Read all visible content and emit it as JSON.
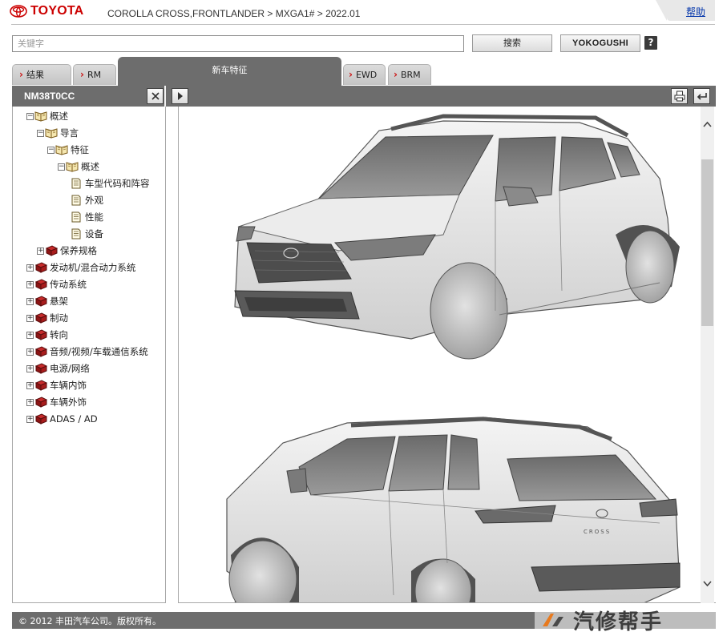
{
  "header": {
    "brand": "TOYOTA",
    "breadcrumb": "COROLLA CROSS,FRONTLANDER > MXGA1# > 2022.01",
    "help_link": "帮助"
  },
  "search": {
    "placeholder": "关键字",
    "search_button": "搜索",
    "yokogushi_button": "YOKOGUSHI",
    "help_icon": "?"
  },
  "tabs": [
    {
      "label": "结果",
      "active": false
    },
    {
      "label": "RM",
      "active": false
    },
    {
      "label": "新车特征",
      "active": true
    },
    {
      "label": "EWD",
      "active": false
    },
    {
      "label": "BRM",
      "active": false
    }
  ],
  "toolbar": {
    "doc_code": "NM38T0CC",
    "close_icon": "close-icon",
    "next_icon": "play-right-icon",
    "print_icon": "print-icon",
    "back_icon": "return-icon"
  },
  "tree": [
    {
      "label": "概述",
      "level": 0,
      "icon": "open-book-icon",
      "expander": "minus"
    },
    {
      "label": "导言",
      "level": 1,
      "icon": "open-book-icon",
      "expander": "minus"
    },
    {
      "label": "特征",
      "level": 2,
      "icon": "open-book-icon",
      "expander": "minus"
    },
    {
      "label": "概述",
      "level": 3,
      "icon": "open-book-icon",
      "expander": "minus"
    },
    {
      "label": "车型代码和阵容",
      "level": 4,
      "icon": "document-icon",
      "expander": "none"
    },
    {
      "label": "外观",
      "level": 4,
      "icon": "document-icon",
      "expander": "none"
    },
    {
      "label": "性能",
      "level": 4,
      "icon": "document-icon",
      "expander": "none"
    },
    {
      "label": "设备",
      "level": 4,
      "icon": "document-icon",
      "expander": "none"
    },
    {
      "label": "保养规格",
      "level": 1,
      "icon": "closed-book-icon",
      "expander": "plus"
    },
    {
      "label": "发动机/混合动力系统",
      "level": 0,
      "icon": "closed-book-icon",
      "expander": "plus"
    },
    {
      "label": "传动系统",
      "level": 0,
      "icon": "closed-book-icon",
      "expander": "plus"
    },
    {
      "label": "悬架",
      "level": 0,
      "icon": "closed-book-icon",
      "expander": "plus"
    },
    {
      "label": "制动",
      "level": 0,
      "icon": "closed-book-icon",
      "expander": "plus"
    },
    {
      "label": "转向",
      "level": 0,
      "icon": "closed-book-icon",
      "expander": "plus"
    },
    {
      "label": "音频/视频/车载通信系统",
      "level": 0,
      "icon": "closed-book-icon",
      "expander": "plus"
    },
    {
      "label": "电源/网络",
      "level": 0,
      "icon": "closed-book-icon",
      "expander": "plus"
    },
    {
      "label": "车辆内饰",
      "level": 0,
      "icon": "closed-book-icon",
      "expander": "plus"
    },
    {
      "label": "车辆外饰",
      "level": 0,
      "icon": "closed-book-icon",
      "expander": "plus"
    },
    {
      "label": "ADAS / AD",
      "level": 0,
      "icon": "closed-book-icon",
      "expander": "plus"
    }
  ],
  "content": {
    "images": [
      "front-three-quarter-vehicle-illustration",
      "rear-three-quarter-vehicle-illustration"
    ],
    "rear_badge": "CROSS"
  },
  "footer": {
    "copyright": "© 2012 丰田汽车公司。版权所有。"
  },
  "watermark": {
    "text": "汽修帮手"
  },
  "colors": {
    "brand_red": "#cc0000",
    "bar_gray": "#6d6d6d",
    "chevron_red": "#cc1111"
  }
}
